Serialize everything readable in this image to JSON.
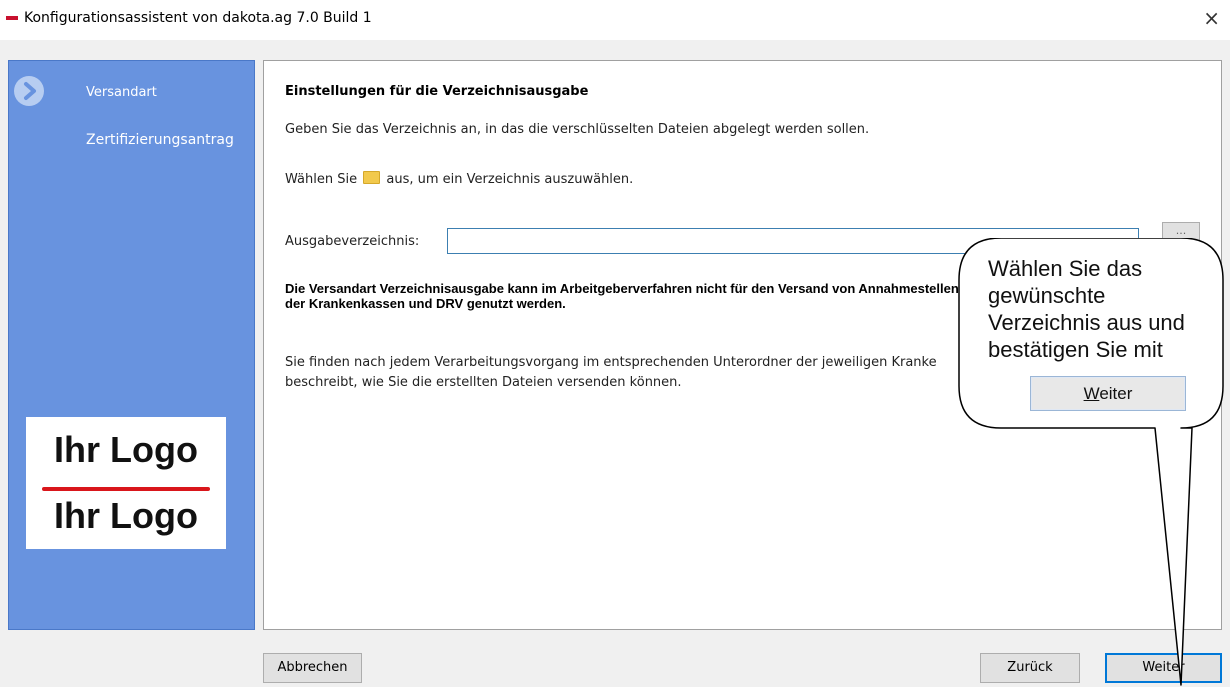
{
  "window": {
    "title": "Konfigurationsassistent von dakota.ag 7.0 Build 1",
    "close_glyph": "×"
  },
  "sidebar": {
    "steps": [
      {
        "label": "Versandart",
        "active": true
      },
      {
        "label": "Zertifizierungsantrag",
        "active": false
      }
    ],
    "logo": {
      "top": "Ihr Logo",
      "bottom": "Ihr Logo"
    }
  },
  "panel": {
    "heading": "Einstellungen für die Verzeichnisausgabe",
    "intro": "Geben Sie das Verzeichnis an, in das die verschlüsselten Dateien abgelegt werden sollen.",
    "choose_prefix": "Wählen Sie",
    "choose_suffix": "aus, um ein Verzeichnis auszuwählen.",
    "field_label": "Ausgabeverzeichnis:",
    "field_value": "",
    "browse_label": "...",
    "warning": "Die Versandart Verzeichnisausgabe kann im Arbeitgeberverfahren nicht für den Versand von Annahmestellen der Krankenkassen und DRV genutzt werden.",
    "info": "Sie finden nach jedem Verarbeitungsvorgang im entsprechenden Unterordner der jeweiligen Kranke beschreibt, wie Sie die erstellten Dateien versenden können."
  },
  "buttons": {
    "cancel": "Abbrechen",
    "back": "Zurück",
    "next": "Weiter"
  },
  "callout": {
    "text": "Wählen Sie das gewünschte Verzeichnis aus und bestätigen Sie mit",
    "button_underlined": "W",
    "button_rest": "eiter"
  },
  "colors": {
    "sidebar": "#6893df",
    "accent": "#0078d7",
    "logo_line": "#d9161b"
  }
}
